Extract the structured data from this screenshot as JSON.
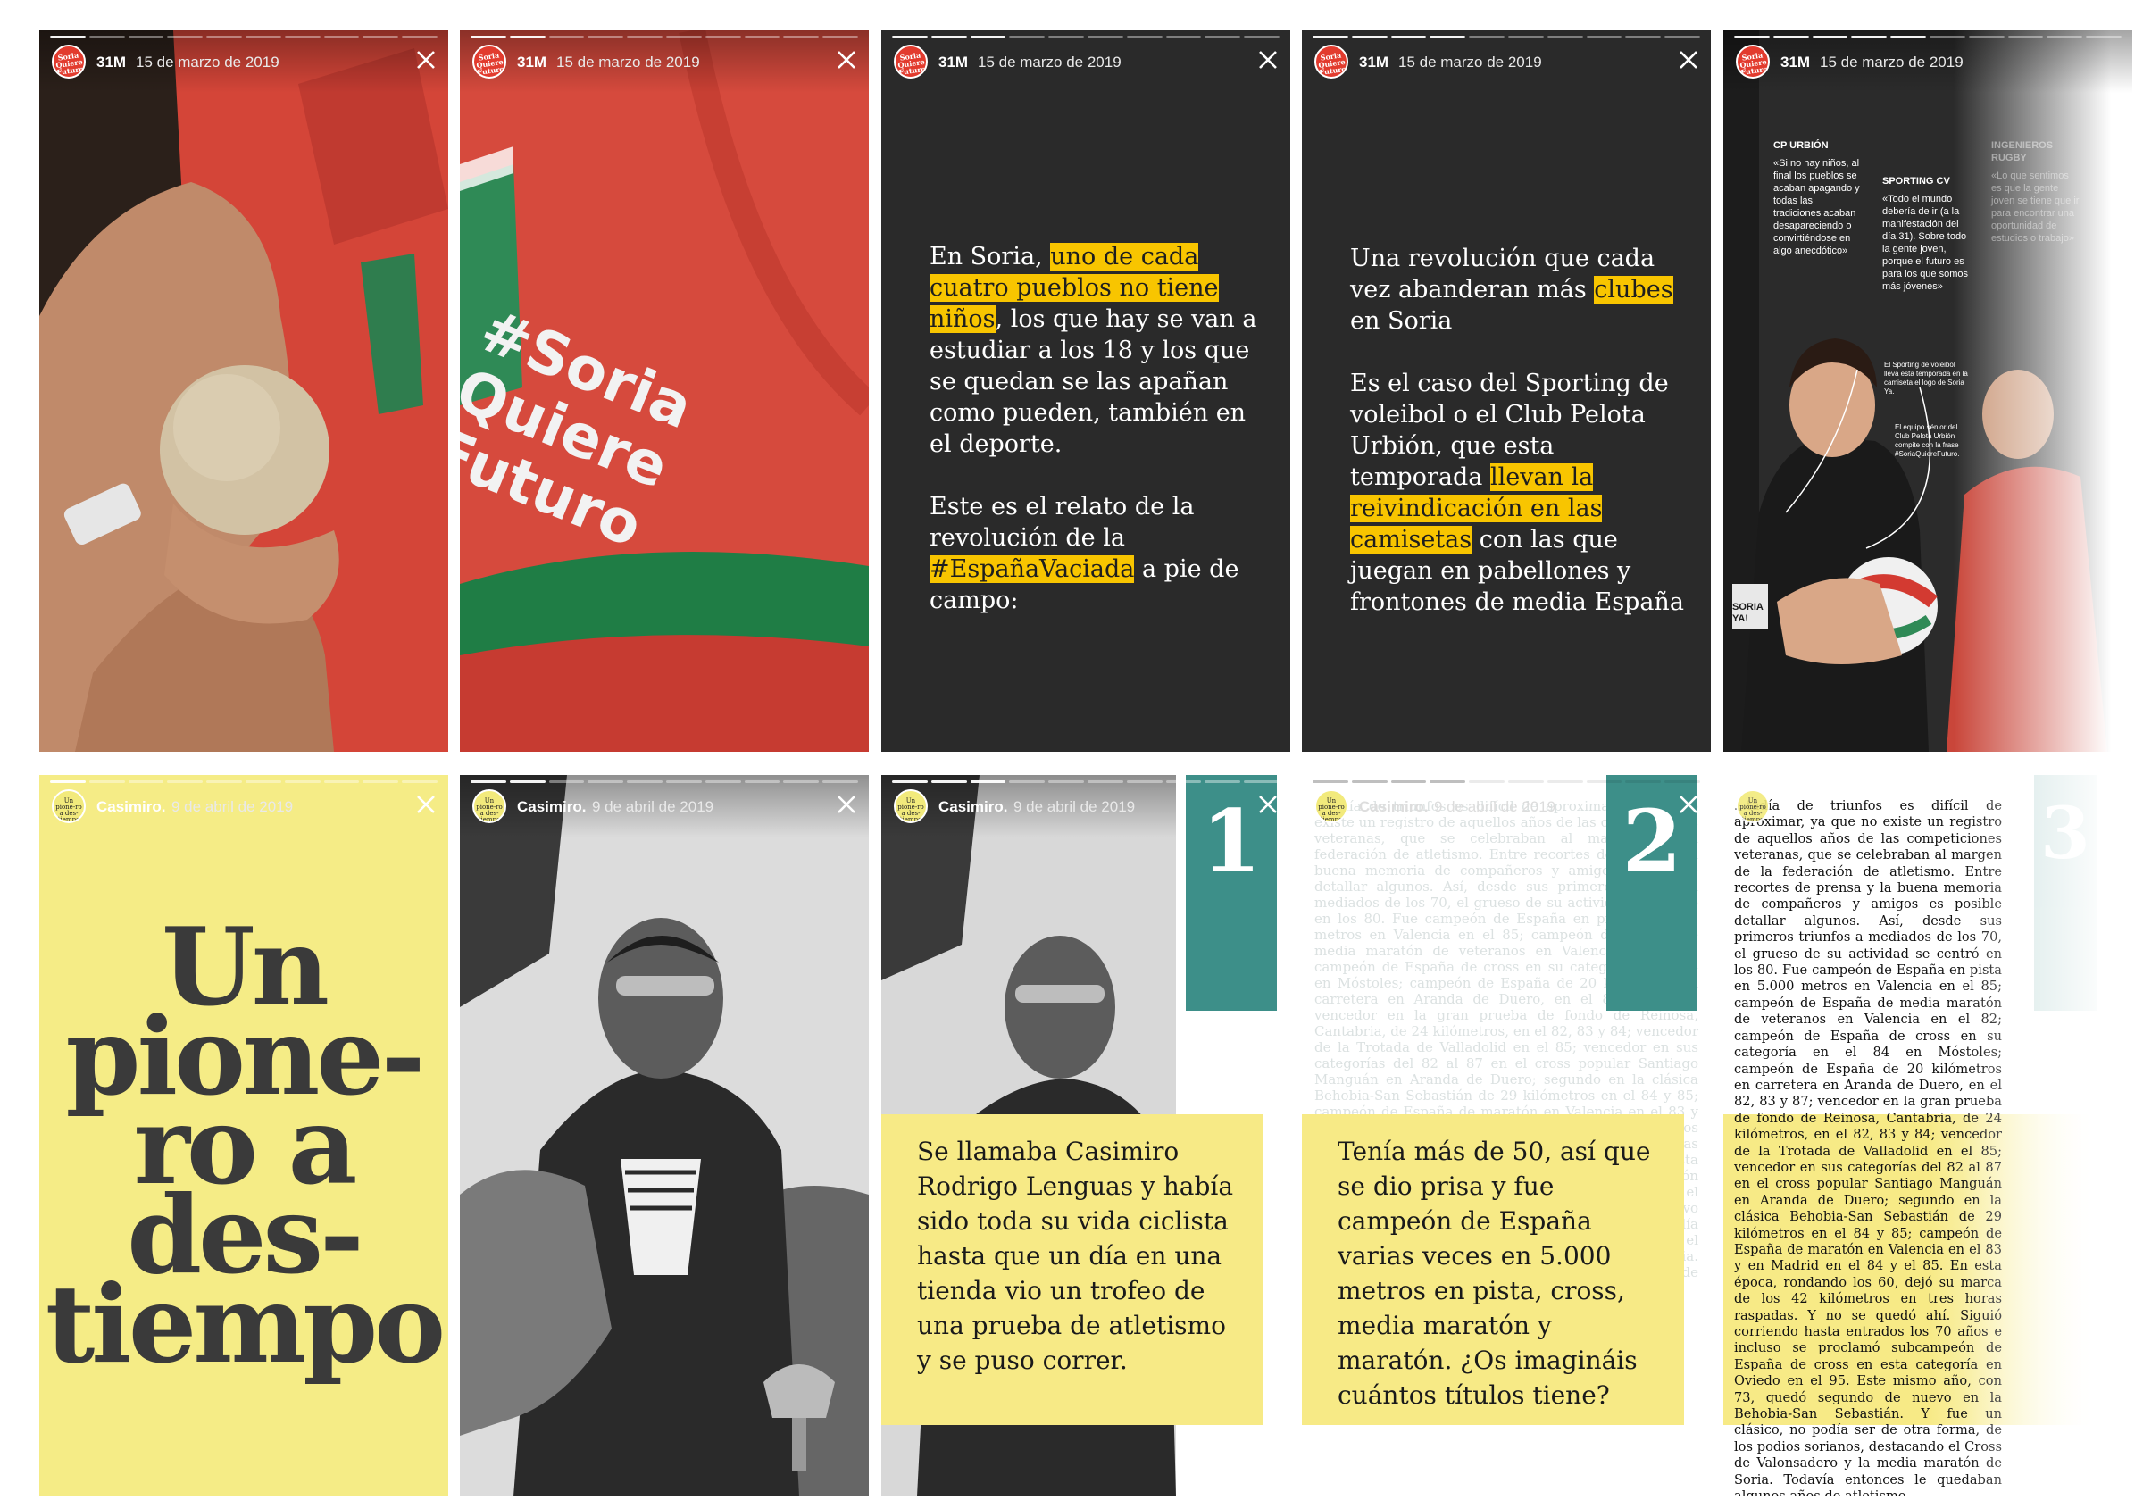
{
  "stories_row1": {
    "user": "31M",
    "date": "15 de marzo de 2019",
    "logo": "Soria Quiere Futuro",
    "shirt_text": [
      "#Soria",
      "Quiere",
      "Futuro"
    ],
    "slide3": {
      "p1_a": "En Soria, ",
      "p1_hl": "uno de cada cuatro pueblos no tiene niños",
      "p1_b": ", los que hay se van a estudiar a los 18 y los que se quedan se las apañan como pueden, también en el deporte.",
      "p2_a": "Este es el relato de la revolución de la ",
      "p2_hl": "#EspañaVaciada",
      "p2_b": " a pie de campo:"
    },
    "slide4": {
      "p1_a": "Una revolución que cada vez abanderan más ",
      "p1_hl": "clubes",
      "p1_b": " en Soria",
      "p2_a": "Es el caso del Sporting de voleibol o el Club Pelota Urbión, que esta temporada ",
      "p2_hl": "llevan la reivindicación en las camisetas",
      "p2_b": " con las que juegan en pabellones y frontones de media España"
    },
    "slide5": {
      "col1_title": "CP URBIÓN",
      "col1_text": "«Si no hay niños, al final los pueblos se acaban apagando y todas las tradiciones acaban desapareciendo o convirtiéndose en algo anecdótico»",
      "col2_title": "SPORTING CV",
      "col2_text": "«Todo el mundo debería de ir (a la manifestación del día 31). Sobre todo la gente joven, porque el futuro es para los que somos más jóvenes»",
      "col3_title": "INGENIEROS RUGBY",
      "col3_text": "«Lo que sentimos es que la gente joven se tiene que ir para encontrar una oportunidad de estudios o trabajo»",
      "caption1": "El Sporting de voleibol lleva esta temporada en la camiseta el logo de Soria Ya.",
      "caption2": "El equipo sénior del Club Pelota Urbión compite con la frase #SoriaQuiereFuturo.",
      "shirt_word": "SORIA YA!"
    }
  },
  "stories_row2": {
    "user": "Casimiro.",
    "date": "9 de abril de 2019",
    "logo": "Un pione-ro a des-tiempo",
    "title_lines": [
      "Un",
      "pione-",
      "ro a",
      "des-",
      "tiempo"
    ],
    "num1": "1",
    "num2": "2",
    "num3": "3",
    "box1": "Se llamaba Casimiro Rodrigo Lenguas y había sido toda su vida ciclista hasta que un día en una tienda vio un trofeo de una prueba de atletismo y se puso correr.",
    "box2": "Tenía más de 50, así que se dio prisa y fue campeón de España varias veces en 5.000 metros en pista, cross, media maratón y maratón. ¿Os imagináis cuántos títulos tiene?",
    "article": "...tadía de triunfos es difícil de aproximar, ya que no existe un registro de aquellos años de las competiciones veteranas, que se celebraban al margen de la federación de atletismo. Entre recortes de prensa y la buena memoria de compañeros y amigos es posible detallar algunos. Así, desde sus primeros triunfos a mediados de los 70, el grueso de su actividad se centró en los 80. Fue campeón de España en pista en 5.000 metros en Valencia en el 85; campeón de España de media maratón de veteranos en Valencia en el 82; campeón de España de cross en su categoría en el 84 en Móstoles; campeón de España de 20 kilómetros en carretera en Aranda de Duero, en el 82, 83 y 87; vencedor en la gran prueba de fondo de Reinosa, Cantabria, de 24 kilómetros, en el 82, 83 y 84; vencedor de la Trotada de Valladolid en el 85; vencedor en sus categorías del 82 al 87 en el cross popular Santiago Manguán en Aranda de Duero; segundo en la clásica Behobia-San Sebastián de 29 kilómetros en el 84 y 85; campeón de España de maratón en Valencia en el 83 y en Madrid en el 84 y el 85. En esta época, rondando los 60, dejó su marca de los 42 kilómetros en tres horas raspadas. Y no se quedó ahí. Siguió corriendo hasta entrados los 70 años e incluso se proclamó subcampeón de España de cross en esta categoría en Oviedo en el 95. Este mismo año, con 73, quedó segundo de nuevo en la Behobia-San Sebastián. Y fue un clásico, no podía ser de otra forma, de los podios sorianos, destacando el Cross de Valonsadero y la media maratón de Soria. Todavía entonces le quedaban algunos años de atletismo."
  },
  "colors": {
    "accent_yellow": "#f8c500",
    "pale_yellow": "#f7ea86",
    "teal": "#3d8f89",
    "dark_bg": "#2a2a2a",
    "shirt_red": "#d8463a",
    "brand_red": "#e23b2e"
  }
}
